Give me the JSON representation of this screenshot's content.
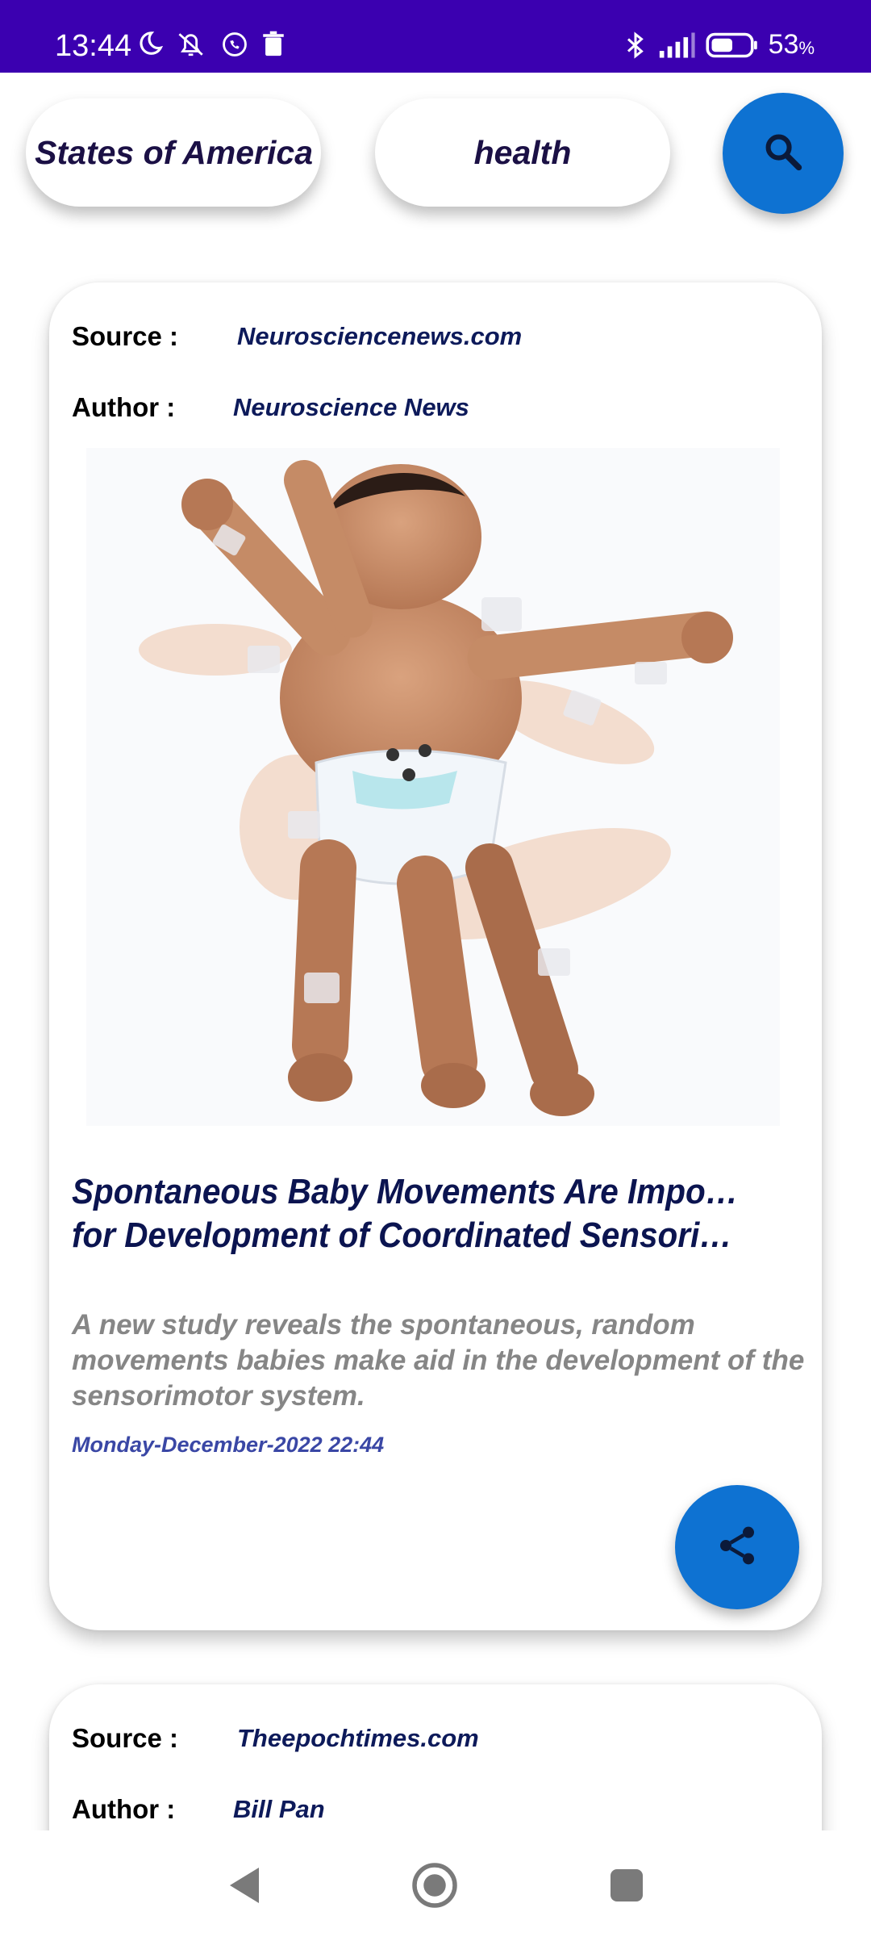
{
  "status_bar": {
    "time": "13:44",
    "battery_percent": "53",
    "battery_unit": "%",
    "left_icons": [
      "moon-icon",
      "notification-off-icon",
      "whatsapp-icon",
      "trash-icon"
    ],
    "right_icons": [
      "bluetooth-icon",
      "signal-icon",
      "battery-icon"
    ]
  },
  "search": {
    "country": "United States of America",
    "category": "health",
    "search_icon": "search-icon"
  },
  "articles": [
    {
      "source_label": "Source :",
      "source": "Neurosciencenews.com",
      "author_label": "Author :",
      "author": "Neuroscience News",
      "title_line1": "Spontaneous Baby Movements Are Important",
      "title_line2": "for Development of Coordinated Sensorimotor S…",
      "description": "A new study reveals the spontaneous, random movements babies make aid in the development of the sensorimotor system.",
      "date": "Monday-December-2022 22:44",
      "share_icon": "share-icon"
    },
    {
      "source_label": "Source :",
      "source": "Theepochtimes.com",
      "author_label": "Author :",
      "author": "Bill Pan"
    }
  ],
  "nav": {
    "back_icon": "back-triangle-icon",
    "home_icon": "home-circle-icon",
    "recent_icon": "recent-square-icon"
  },
  "colors": {
    "status_bar": "#3b00b0",
    "fab": "#0e72d2",
    "title": "#0b1450",
    "date": "#3a47a5",
    "description": "#868686"
  }
}
